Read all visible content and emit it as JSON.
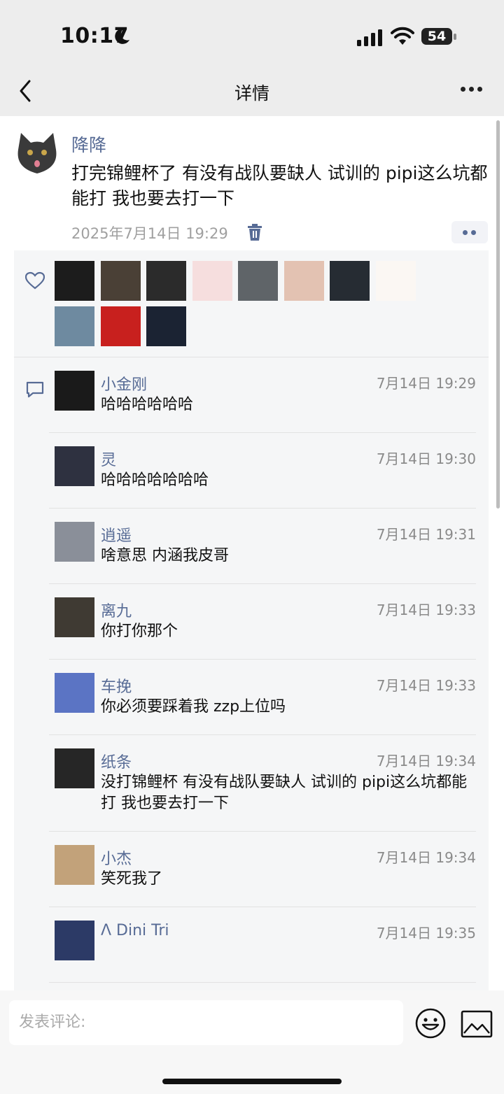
{
  "status_bar": {
    "time": "10:17",
    "battery": "54"
  },
  "nav": {
    "title": "详情"
  },
  "post": {
    "author": "降降",
    "text": "打完锦鲤杯了 有没有战队要缺人 试训的 pipi这么坑都能打 我也要去打一下",
    "date": "2025年7月14日 19:29"
  },
  "likers": [
    {
      "color": "#1c1c1c",
      "icon": "avatar-dark-figure"
    },
    {
      "color": "#4a4036",
      "icon": "avatar-street-photo"
    },
    {
      "color": "#2b2b2b",
      "icon": "avatar-anime-glasses"
    },
    {
      "color": "#f6dede",
      "icon": "avatar-pink-cartoon"
    },
    {
      "color": "#5f6468",
      "icon": "avatar-landscape"
    },
    {
      "color": "#e3c2b2",
      "icon": "avatar-child-photo"
    },
    {
      "color": "#262c33",
      "icon": "avatar-anime-dark"
    },
    {
      "color": "#fbf7f3",
      "icon": "avatar-text-image"
    },
    {
      "color": "#6e8aa0",
      "icon": "avatar-seaside"
    },
    {
      "color": "#c8201e",
      "icon": "avatar-flag-cartoon"
    },
    {
      "color": "#1b2333",
      "icon": "avatar-night-light"
    }
  ],
  "comments": [
    {
      "name": "小金刚",
      "time": "7月14日 19:29",
      "text": "哈哈哈哈哈哈",
      "color": "#1a1a1a"
    },
    {
      "name": "灵",
      "time": "7月14日 19:30",
      "text": "哈哈哈哈哈哈哈",
      "color": "#2e3140"
    },
    {
      "name": "逍遥",
      "time": "7月14日 19:31",
      "text": "啥意思  内涵我皮哥",
      "color": "#8a8f99"
    },
    {
      "name": "离九",
      "time": "7月14日 19:33",
      "text": "你打你那个",
      "color": "#3f3a33"
    },
    {
      "name": "车挽",
      "time": "7月14日 19:33",
      "text": "你必须要踩着我 zzp上位吗",
      "color": "#5b74c4"
    },
    {
      "name": "纸条",
      "time": "7月14日 19:34",
      "text": "没打锦鲤杯 有没有战队要缺人 试训的 pipi这么坑都能打 我也要去打一下",
      "color": "#262626"
    },
    {
      "name": "小杰",
      "time": "7月14日 19:34",
      "text": "笑死我了",
      "color": "#c2a27a"
    },
    {
      "name": "Λ Dini Tri",
      "time": "7月14日 19:35",
      "text": "",
      "color": "#2c3a66"
    }
  ],
  "input": {
    "placeholder": "发表评论:"
  }
}
